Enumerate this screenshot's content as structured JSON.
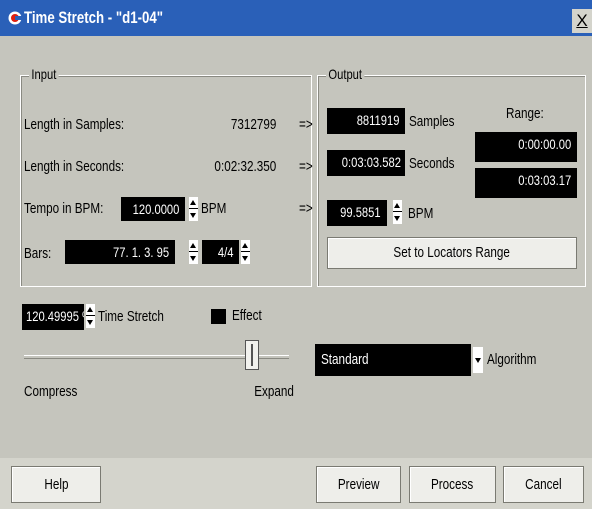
{
  "window": {
    "title": "Time Stretch - \"d1-04\"",
    "close_label": "X"
  },
  "input": {
    "legend": "Input",
    "length_samples_label": "Length in Samples:",
    "length_samples_value": "7312799",
    "length_seconds_label": "Length in Seconds:",
    "length_seconds_value": "0:02:32.350",
    "tempo_label": "Tempo in BPM:",
    "tempo_value": "120.0000",
    "tempo_unit": "BPM",
    "bars_label": "Bars:",
    "bars_value": "77. 1. 3. 95",
    "signature_value": "4/4"
  },
  "arrows": [
    "=>",
    "=>",
    "=>"
  ],
  "output": {
    "legend": "Output",
    "samples_value": "8811919",
    "samples_label": "Samples",
    "seconds_value": "0:03:03.582",
    "seconds_label": "Seconds",
    "bpm_value": "99.5851",
    "bpm_label": "BPM",
    "range_label": "Range:",
    "range_start": "0:00:00.00",
    "range_end": "0:03:03.17",
    "set_locators_button": "Set to Locators Range"
  },
  "stretch": {
    "value": "120.49995 %",
    "label": "Time Stretch",
    "effect_label": "Effect",
    "compress_label": "Compress",
    "expand_label": "Expand",
    "slider_level": 0.88
  },
  "algorithm": {
    "selected": "Standard",
    "label": "Algorithm"
  },
  "buttons": {
    "help": "Help",
    "preview": "Preview",
    "process": "Process",
    "cancel": "Cancel"
  },
  "colors": {
    "titlebar": "#2a60b8",
    "field_bg": "#000000",
    "field_text": "#ffffff",
    "panel": "#c5c5bd"
  }
}
